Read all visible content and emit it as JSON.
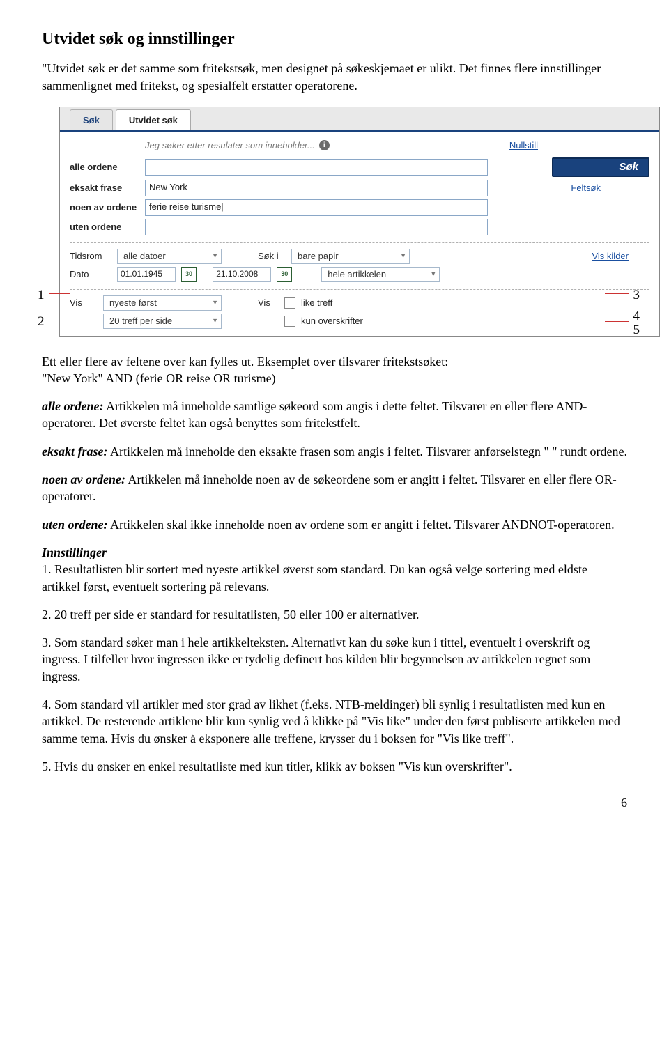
{
  "heading": "Utvidet søk og innstillinger",
  "intro": "\"Utvidet søk er det samme som fritekstsøk, men designet på søkeskjemaet er ulikt. Det finnes flere innstillinger sammenlignet med fritekst, og spesialfelt erstatter operatorene.",
  "screenshot": {
    "tabs": {
      "search": "Søk",
      "advanced": "Utvidet søk"
    },
    "prompt": "Jeg søker etter resulater som inneholder...",
    "reset": "Nullstill",
    "labels": {
      "all": "alle ordene",
      "exact": "eksakt frase",
      "any": "noen av ordene",
      "none": "uten ordene"
    },
    "values": {
      "all": "",
      "exact": "New York",
      "any": "ferie reise turisme|",
      "none": ""
    },
    "buttons": {
      "sok": "Søk",
      "feltsok": "Feltsøk",
      "viskilder": "Vis kilder"
    },
    "opt": {
      "tidsrom_label": "Tidsrom",
      "tidsrom_value": "alle datoer",
      "dato_label": "Dato",
      "date_from": "01.01.1945",
      "date_to": "21.10.2008",
      "soki_label": "Søk i",
      "soki_value1": "bare papir",
      "soki_value2": "hele artikkelen",
      "vis1_label": "Vis",
      "vis1_value": "nyeste først",
      "vis2_value": "20 treff per side",
      "vis3_label": "Vis",
      "cb1": "like treff",
      "cb2": "kun overskrifter"
    },
    "markers": {
      "m1": "1",
      "m2": "2",
      "m3": "3",
      "m4": "4",
      "m5": "5"
    }
  },
  "body": {
    "p1a": "Ett eller flere av feltene over kan fylles ut. Eksemplet over tilsvarer fritekstsøket:",
    "p1b": "\"New York\" AND (ferie OR reise OR turisme)",
    "alle_term": "alle ordene:",
    "alle_txt": " Artikkelen må inneholde samtlige søkeord som angis i dette feltet. Tilsvarer en eller flere AND-operatorer. Det øverste feltet kan også benyttes som fritekstfelt.",
    "eksakt_term": "eksakt frase:",
    "eksakt_txt": " Artikkelen må inneholde den eksakte frasen som angis i feltet. Tilsvarer anførselstegn \" \" rundt ordene.",
    "noen_term": "noen av ordene:",
    "noen_txt": " Artikkelen må inneholde noen av de søkeordene som er angitt i feltet. Tilsvarer en eller flere OR-operatorer.",
    "uten_term": "uten ordene:",
    "uten_txt": " Artikkelen skal ikke inneholde noen av ordene som er angitt i feltet. Tilsvarer ANDNOT-operatoren.",
    "innst_head": "Innstillinger",
    "li1": "1. Resultatlisten blir sortert med nyeste artikkel øverst som standard. Du kan også velge sortering med eldste artikkel først, eventuelt sortering på relevans.",
    "li2": "2. 20 treff per side er standard for resultatlisten, 50 eller 100 er alternativer.",
    "li3": "3. Som standard søker man i hele artikkelteksten. Alternativt kan du søke kun i tittel, eventuelt i overskrift og ingress. I tilfeller hvor ingressen ikke er tydelig definert hos kilden blir begynnelsen av artikkelen regnet som ingress.",
    "li4": "4. Som standard vil artikler med stor grad av likhet (f.eks. NTB-meldinger) bli synlig i resultatlisten med kun en artikkel. De resterende artiklene blir kun synlig ved å klikke på \"Vis like\" under den først publiserte artikkelen med samme tema. Hvis du ønsker å eksponere alle treffene, krysser du i boksen for \"Vis like treff\".",
    "li5": "5. Hvis du ønsker en enkel resultatliste med kun titler, klikk av boksen \"Vis kun overskrifter\"."
  },
  "pagenum": "6"
}
